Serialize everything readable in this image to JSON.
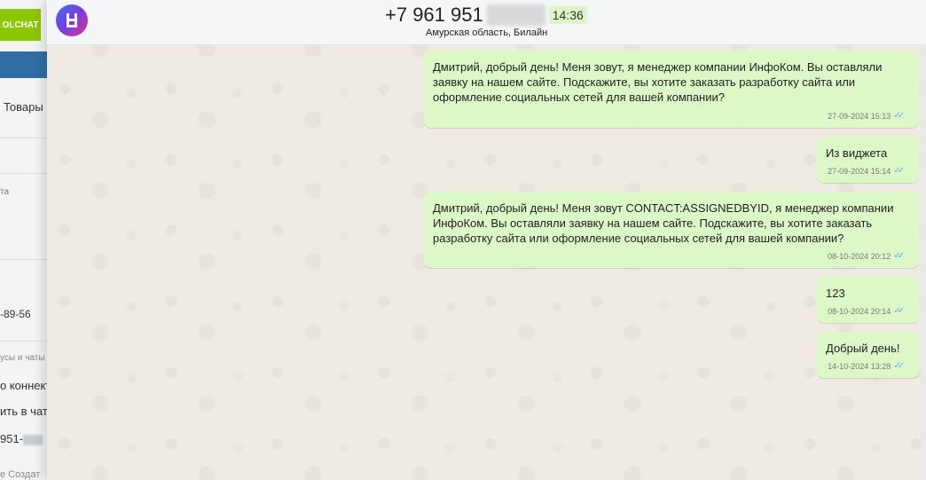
{
  "left_panel": {
    "brand_label": "OLCHAT",
    "tab_label": "Товары",
    "text_fragment_1": "та",
    "phone_fragment": "-89-56",
    "section_label": "усы и чаты",
    "connector_label": "о коннекто",
    "chat_label": "ить в чат",
    "phone_prefix": "951-",
    "create_label": "е  Создат"
  },
  "header": {
    "phone": "+7 961 951",
    "time": "14:36",
    "region": "Амурская область, Билайн"
  },
  "messages": [
    {
      "text": "Дмитрий, добрый день! Меня зовут, я менеджер компании ИнфоКом. Вы оставляли заявку на нашем сайте. Подскажите, вы хотите заказать разработку сайта или оформление социальных сетей для вашей компании?",
      "time": "27-09-2024 15:13"
    },
    {
      "text": "Из виджета",
      "time": "27-09-2024 15:14"
    },
    {
      "text": "Дмитрий, добрый день! Меня зовут CONTACT:ASSIGNEDBYID, я менеджер компании ИнфоКом. Вы оставляли заявку на нашем сайте. Подскажите, вы хотите заказать разработку сайта или оформление социальных сетей для вашей компании?",
      "time": "08-10-2024 20:12"
    },
    {
      "text": "123",
      "time": "08-10-2024 20:14"
    },
    {
      "text": "Добрый день!",
      "time": "14-10-2024 13:28"
    }
  ],
  "colors": {
    "brand": "#8cc600",
    "bubble": "#dcf8c6",
    "ticks": "#4fb6ec",
    "chat_bg": "#efeae2"
  }
}
